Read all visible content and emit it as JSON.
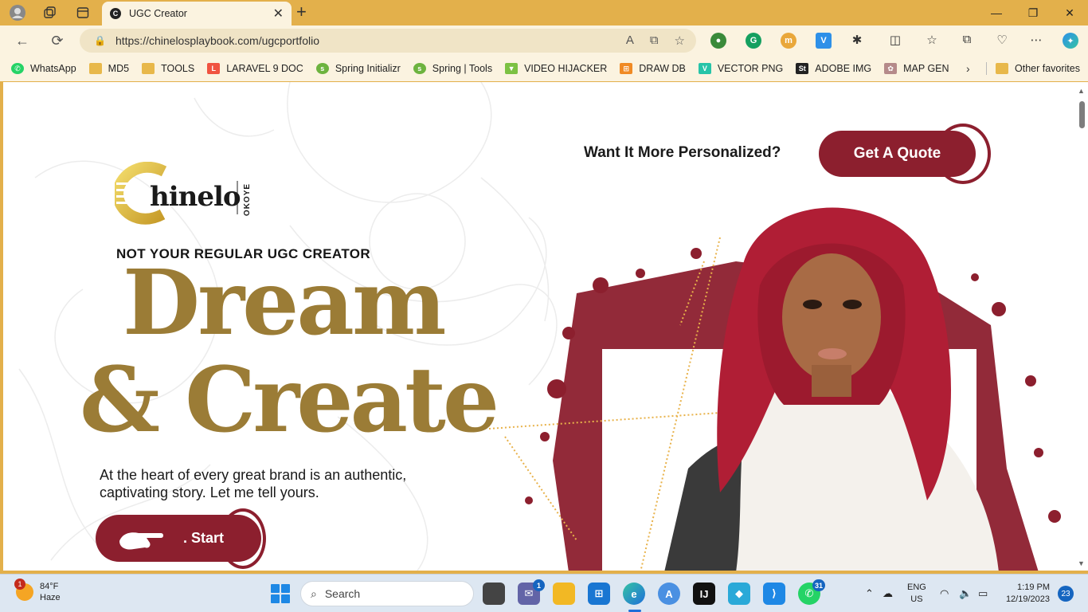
{
  "browser": {
    "tab_title": "UGC Creator",
    "address": "https://chinelosplaybook.com/ugcportfolio",
    "bookmarks": [
      "WhatsApp",
      "MD5",
      "TOOLS",
      "LARAVEL 9 DOC",
      "Spring Initializr",
      "Spring | Tools",
      "VIDEO HIJACKER",
      "DRAW DB",
      "VECTOR PNG",
      "ADOBE IMG",
      "MAP GEN"
    ],
    "other_favorites": "Other favorites"
  },
  "page": {
    "personalized_question": "Want It More Personalized?",
    "quote_button": "Get A Quote",
    "logo_text": "hinelo",
    "logo_sub": "OKOYE",
    "tagline": "NOT YOUR REGULAR UGC CREATOR",
    "headline_1": "Dream",
    "headline_2": "& Create",
    "description": "At the heart of every great brand is an authentic, captivating story. Let me tell yours.",
    "start_button": ". Start"
  },
  "taskbar": {
    "weather_temp": "84°F",
    "weather_desc": "Haze",
    "weather_badge": "1",
    "search_placeholder": "Search",
    "chat_badge": "1",
    "whatsapp_badge": "31",
    "lang_1": "ENG",
    "lang_2": "US",
    "time": "1:19 PM",
    "date": "12/19/2023",
    "notifications": "23"
  },
  "colors": {
    "brand_maroon": "#8c1f2e",
    "brand_gold": "#9b7c36",
    "chrome_gold": "#e3b04b"
  }
}
